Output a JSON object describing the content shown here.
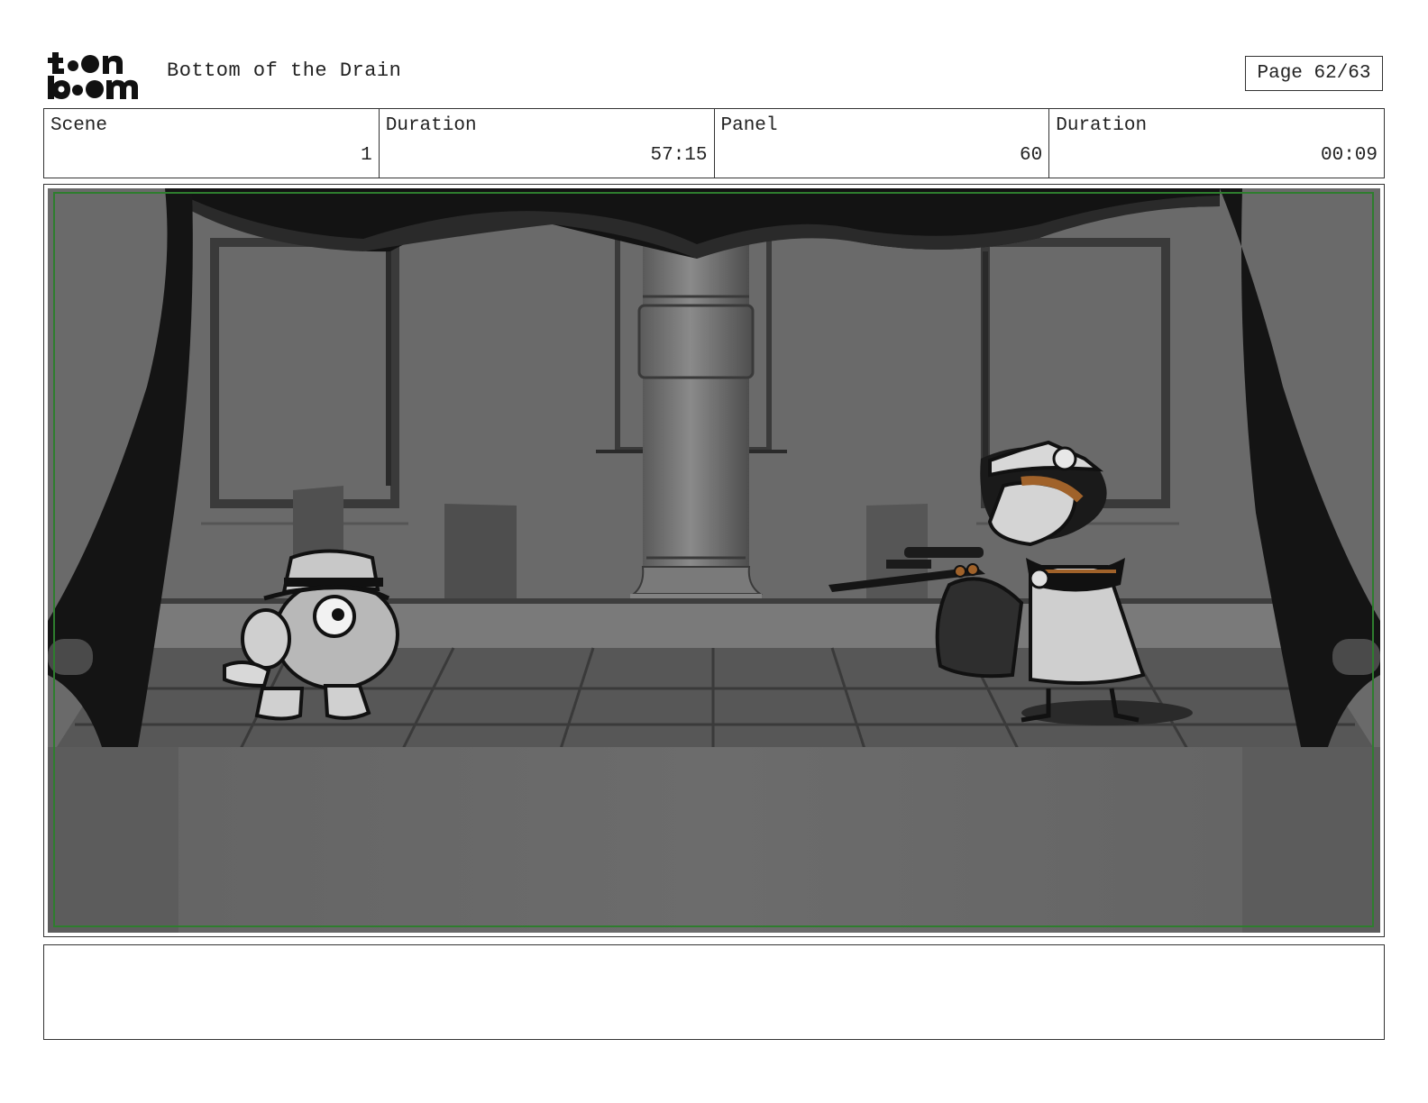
{
  "header": {
    "logo_text": "toon boom",
    "project_title": "Bottom of the Drain",
    "page_label": "Page 62/63"
  },
  "info": [
    {
      "label": "Scene",
      "value": "1"
    },
    {
      "label": "Duration",
      "value": "57:15"
    },
    {
      "label": "Panel",
      "value": "60"
    },
    {
      "label": "Duration",
      "value": "00:09"
    }
  ],
  "notes": {
    "text": ""
  },
  "colors": {
    "safe_frame": "#2e7d2e",
    "scene_wall": "#6a6a6a",
    "scene_floor": "#505050",
    "curtain": "#151515",
    "accent_brown": "#a0622a"
  }
}
